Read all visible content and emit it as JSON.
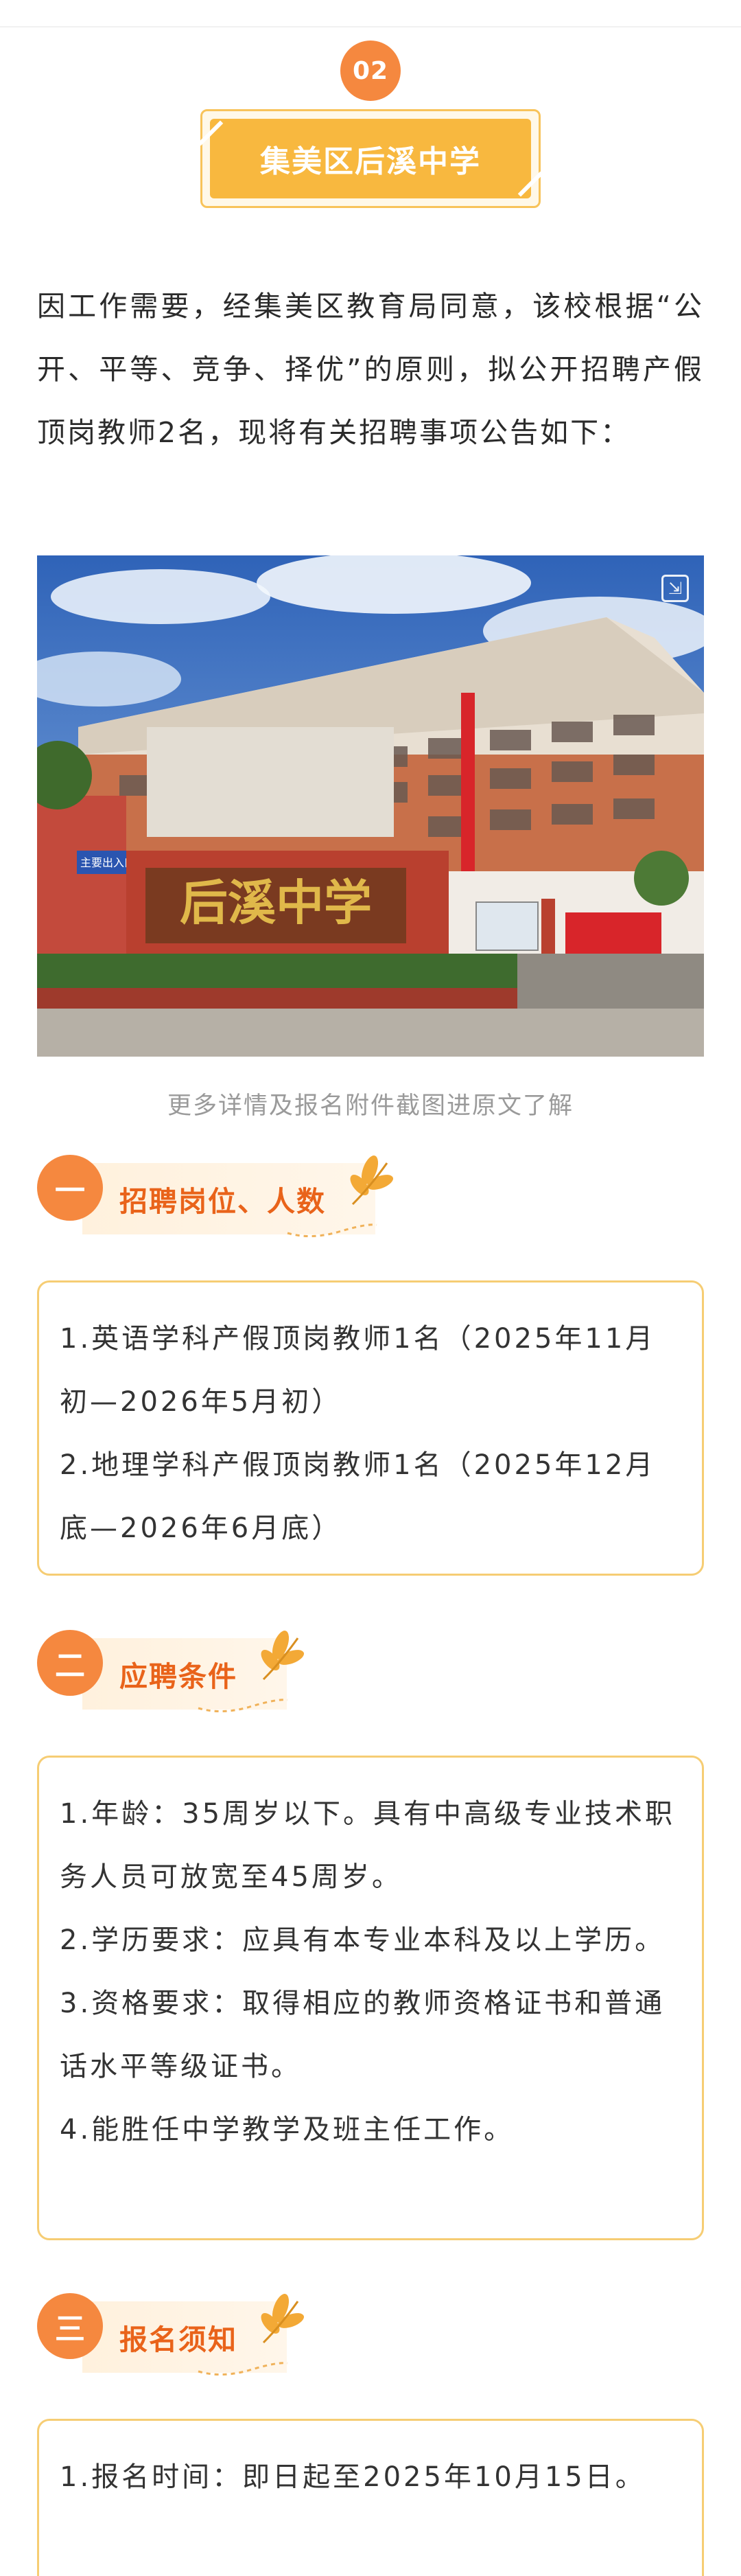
{
  "badge": {
    "number": "02"
  },
  "school_banner": {
    "title": "集美区后溪中学"
  },
  "intro": {
    "text": "因工作需要，经集美区教育局同意，该校根据“公开、平等、竞争、择优”的原则，拟公开招聘产假顶岗教师2名，现将有关招聘事项公告如下："
  },
  "photo": {
    "school_name_sign": "后溪中学",
    "gate_sign": "主要出入口",
    "expand_icon": "expand-icon"
  },
  "caption": {
    "text": "更多详情及报名附件截图进原文了解"
  },
  "sections": [
    {
      "number": "一",
      "title": "招聘岗位、人数",
      "items": [
        "1.英语学科产假顶岗教师1名（2025年11月初—2026年5月初）",
        "2.地理学科产假顶岗教师1名（2025年12月底—2026年6月底）"
      ]
    },
    {
      "number": "二",
      "title": "应聘条件",
      "items": [
        "1.年龄：35周岁以下。具有中高级专业技术职务人员可放宽至45周岁。",
        "2.学历要求：应具有本专业本科及以上学历。",
        "3.资格要求：取得相应的教师资格证书和普通话水平等级证书。",
        "4.能胜任中学教学及班主任工作。"
      ]
    },
    {
      "number": "三",
      "title": "报名须知",
      "items": [
        "1.报名时间：即日起至2025年10月15日。"
      ]
    }
  ],
  "colors": {
    "accent_orange": "#f5883f",
    "banner_yellow": "#f8b83f",
    "border_gold": "#f6cd74",
    "title_orange": "#e9631a"
  }
}
